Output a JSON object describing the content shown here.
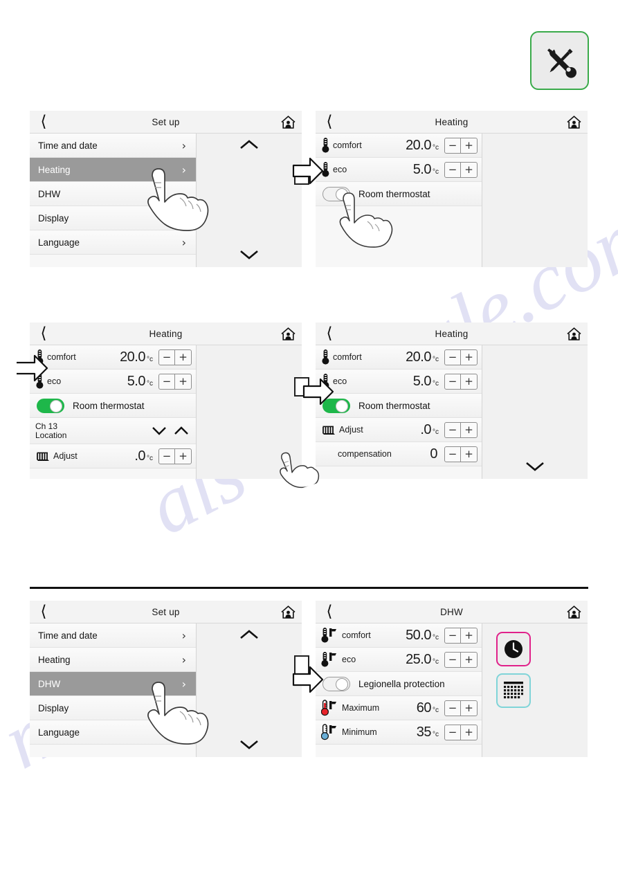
{
  "tool_badge": {
    "icon": "tools-icon",
    "border_color": "#3aaa4a"
  },
  "watermark": {
    "line1": "ale.com",
    "line2": "als",
    "line3": "manuale"
  },
  "common": {
    "back_icon": "back-chevron-icon",
    "home_icon": "home-person-icon",
    "minus_label": "−",
    "plus_label": "+",
    "chevron_right": "›",
    "chevron_up_icon": "chevron-up-icon",
    "chevron_down_icon": "chevron-down-icon"
  },
  "screens": {
    "setup_1": {
      "title": "Set up",
      "items": [
        {
          "label": "Time and date",
          "selected": false,
          "chevron": "›"
        },
        {
          "label": "Heating",
          "selected": true,
          "chevron": "›"
        },
        {
          "label": "DHW",
          "selected": false,
          "chevron": "›"
        },
        {
          "label": "Display",
          "selected": false,
          "chevron": "›"
        },
        {
          "label": "Language",
          "selected": false,
          "chevron": "›"
        }
      ]
    },
    "heating_1": {
      "title": "Heating",
      "comfort": {
        "label": "comfort",
        "value": "20.0",
        "unit": "°c"
      },
      "eco": {
        "label": "eco",
        "value": "5.0",
        "unit": "°c"
      },
      "room_thermostat": {
        "label": "Room thermostat",
        "state": "off"
      }
    },
    "heating_2": {
      "title": "Heating",
      "comfort": {
        "label": "comfort",
        "value": "20.0",
        "unit": "°c"
      },
      "eco": {
        "label": "eco",
        "value": "5.0",
        "unit": "°c"
      },
      "room_thermostat": {
        "label": "Room thermostat",
        "state": "on"
      },
      "location": {
        "line1": "Ch 13",
        "line2": "Location"
      },
      "adjust": {
        "label": "Adjust",
        "value": ".0",
        "unit": "°c"
      }
    },
    "heating_3": {
      "title": "Heating",
      "comfort": {
        "label": "comfort",
        "value": "20.0",
        "unit": "°c"
      },
      "eco": {
        "label": "eco",
        "value": "5.0",
        "unit": "°c"
      },
      "room_thermostat": {
        "label": "Room thermostat",
        "state": "on"
      },
      "adjust": {
        "label": "Adjust",
        "value": ".0",
        "unit": "°c"
      },
      "compensation": {
        "label": "compensation",
        "value": "0",
        "unit": ""
      }
    },
    "setup_2": {
      "title": "Set up",
      "items": [
        {
          "label": "Time and date",
          "selected": false,
          "chevron": "›"
        },
        {
          "label": "Heating",
          "selected": false,
          "chevron": "›"
        },
        {
          "label": "DHW",
          "selected": true,
          "chevron": "›"
        },
        {
          "label": "Display",
          "selected": false,
          "chevron": "›"
        },
        {
          "label": "Language",
          "selected": false,
          "chevron": "›"
        }
      ]
    },
    "dhw": {
      "title": "DHW",
      "comfort": {
        "label": "comfort",
        "value": "50.0",
        "unit": "°c"
      },
      "eco": {
        "label": "eco",
        "value": "25.0",
        "unit": "°c"
      },
      "legionella": {
        "label": "Legionella protection",
        "state": "off"
      },
      "maximum": {
        "label": "Maximum",
        "value": "60",
        "unit": "°c"
      },
      "minimum": {
        "label": "Minimum",
        "value": "35",
        "unit": "°c"
      },
      "side_buttons": [
        {
          "icon": "clock-icon",
          "border_color": "#e0218a"
        },
        {
          "icon": "calendar-icon",
          "border_color": "#7fd4d8"
        }
      ]
    }
  }
}
